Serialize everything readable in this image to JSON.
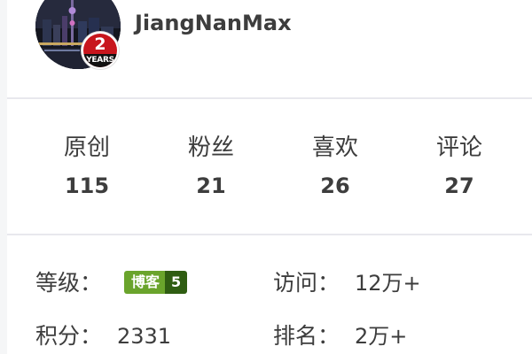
{
  "profile": {
    "username": "JiangNanMax",
    "badge_number": "2",
    "badge_label": "YEARS"
  },
  "stats": [
    {
      "label": "原创",
      "value": "115"
    },
    {
      "label": "粉丝",
      "value": "21"
    },
    {
      "label": "喜欢",
      "value": "26"
    },
    {
      "label": "评论",
      "value": "27"
    }
  ],
  "info": {
    "level_label": "等级：",
    "level_badge_text": "博客",
    "level_badge_number": "5",
    "visits_label": "访问：",
    "visits_value": "12万+",
    "points_label": "积分：",
    "points_value": "2331",
    "rank_label": "排名：",
    "rank_value": "2万+"
  },
  "colors": {
    "badge_red": "#c8161d",
    "level_green": "#6aa42c",
    "level_dark_green": "#2f5d12",
    "text": "#3d3d3d",
    "divider": "#e8e8ed"
  },
  "icons": {
    "avatar": "night-city-skyline-photo",
    "years_badge": "anniversary-badge-icon"
  }
}
